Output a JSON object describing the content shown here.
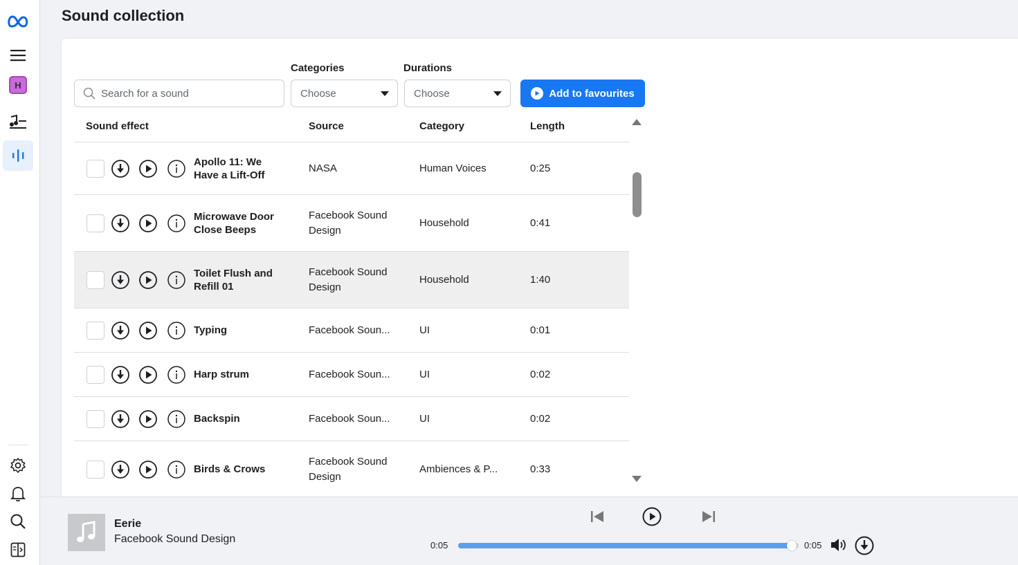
{
  "app": {
    "page_title": "Sound collection",
    "workspace_initial": "H",
    "accent_color": "#1877f2"
  },
  "sidebar": {
    "items": [
      {
        "name": "meta-logo-icon"
      },
      {
        "name": "menu-icon"
      },
      {
        "name": "workspace-avatar"
      },
      {
        "name": "music-library-icon"
      },
      {
        "name": "sound-collection-icon",
        "active": true
      },
      {
        "name": "settings-icon"
      },
      {
        "name": "notifications-icon"
      },
      {
        "name": "search-icon"
      },
      {
        "name": "panel-toggle-icon"
      }
    ]
  },
  "filters": {
    "search_placeholder": "Search for a sound",
    "categories_label": "Categories",
    "categories_value": "Choose",
    "durations_label": "Durations",
    "durations_value": "Choose",
    "add_favourites_label": "Add to favourites"
  },
  "table": {
    "columns": [
      "Sound effect",
      "Source",
      "Category",
      "Length"
    ],
    "rows": [
      {
        "name_1": "Apollo 11: We",
        "name_2": "Have a Lift-Off",
        "source_1": "NASA",
        "source_2": "",
        "category": "Human Voices",
        "length": "0:25"
      },
      {
        "name_1": "Microwave Door",
        "name_2": "Close Beeps",
        "source_1": "Facebook Sound",
        "source_2": "Design",
        "category": "Household",
        "length": "0:41"
      },
      {
        "name_1": "Toilet Flush and",
        "name_2": "Refill 01",
        "source_1": "Facebook Sound",
        "source_2": "Design",
        "category": "Household",
        "length": "1:40"
      },
      {
        "name_1": "Typing",
        "name_2": "",
        "source_1": "Facebook Soun...",
        "source_2": "",
        "category": "UI",
        "length": "0:01"
      },
      {
        "name_1": "Harp strum",
        "name_2": "",
        "source_1": "Facebook Soun...",
        "source_2": "",
        "category": "UI",
        "length": "0:02"
      },
      {
        "name_1": "Backspin",
        "name_2": "",
        "source_1": "Facebook Soun...",
        "source_2": "",
        "category": "UI",
        "length": "0:02"
      },
      {
        "name_1": "Birds & Crows",
        "name_2": "",
        "source_1": "Facebook Sound",
        "source_2": "Design",
        "category": "Ambiences & P...",
        "length": "0:33"
      }
    ]
  },
  "player": {
    "title": "Eerie",
    "artist": "Facebook Sound Design",
    "elapsed": "0:05",
    "total": "0:05",
    "progress": 0.98
  }
}
